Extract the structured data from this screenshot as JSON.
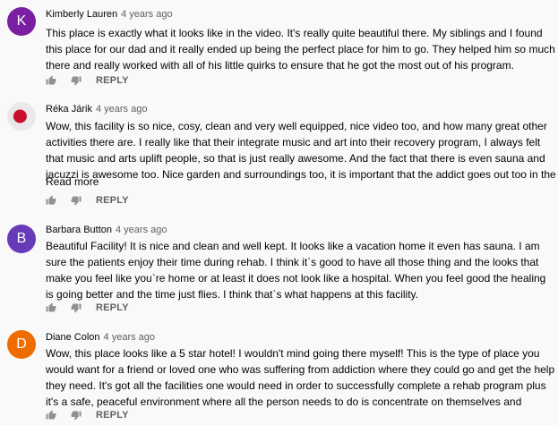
{
  "comments": [
    {
      "author": "Kimberly Lauren",
      "time": "4 years ago",
      "avatar_letter": "K",
      "avatar_color": "#7b1fa2",
      "text": "This place is exactly what it looks like in the video. It's really quite beautiful there. My siblings and I found this place for our dad and it really ended up being the perfect place for him to go. They helped him so much there and really worked with all of his little quirks to ensure that he got the most out of his program.",
      "reply_label": "REPLY"
    },
    {
      "author": "Réka Járik",
      "time": "4 years ago",
      "avatar_letter": "",
      "avatar_color": "#e9e9e9",
      "text": "Wow, this facility is so nice, cosy, clean and very well equipped, nice video too, and how many great other activities there are. I really like that their integrate music and art into their recovery program, I always felt that music and arts uplift people, so that is just really awesome. And the fact that there is even sauna and jacuzzi is awesome too. Nice garden and surroundings too, it is important that the addict goes out too in the fresh air and enjoys the sun too, that …",
      "read_more": "Read more",
      "reply_label": "REPLY"
    },
    {
      "author": "Barbara Button",
      "time": "4 years ago",
      "avatar_letter": "B",
      "avatar_color": "#673ab7",
      "text": "Beautiful Facility! It is nice and clean and well kept. It looks like a vacation home it even has sauna. I am sure the patients enjoy their time during rehab. I think it`s good to have all those thing and the looks that make you feel like you`re home or at least it does not look like a hospital. When you feel good the healing is going better and the time just flies. I think that`s what happens at this facility.",
      "reply_label": "REPLY"
    },
    {
      "author": "Diane Colon",
      "time": "4 years ago",
      "avatar_letter": "D",
      "avatar_color": "#ef6c00",
      "text": "Wow, this place looks like a 5 star hotel!  I wouldn't mind going there myself!  This is the type of place you would want for a friend or loved one who was suffering from addiction where they could go and get the help they need.  It's got all the facilities one would need in order to successfully complete a rehab program plus it's a safe, peaceful environment where all the person needs to do is concentrate on themselves and getting through their program.  The fact that you …",
      "reply_label": "REPLY"
    }
  ]
}
